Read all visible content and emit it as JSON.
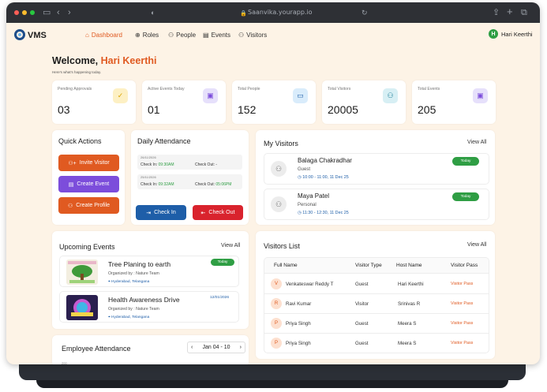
{
  "browser": {
    "url": "Saanvika.yourapp.io"
  },
  "app": {
    "brand": "VMS"
  },
  "nav": {
    "items": [
      {
        "label": "Dashboard",
        "icon": "home-icon"
      },
      {
        "label": "Roles",
        "icon": "roles-icon"
      },
      {
        "label": "People",
        "icon": "people-icon"
      },
      {
        "label": "Events",
        "icon": "calendar-icon"
      },
      {
        "label": "Visitors",
        "icon": "visitors-icon"
      }
    ],
    "user": {
      "initial": "H",
      "name": "Hari Keerthi"
    }
  },
  "welcome": {
    "greeting": "Welcome,",
    "name": "Hari Keerthi",
    "subtitle": "Here's what's happening today."
  },
  "stats": [
    {
      "label": "Pending Approvals",
      "value": "03",
      "color": "#fdf0c4",
      "icon": "check-icon"
    },
    {
      "label": "Active Events Today",
      "value": "01",
      "color": "#e6e0fb",
      "icon": "ticket-icon"
    },
    {
      "label": "Total People",
      "value": "152",
      "color": "#d9ecfb",
      "icon": "briefcase-icon"
    },
    {
      "label": "Total Visitors",
      "value": "20005",
      "color": "#d7eff4",
      "icon": "people-icon"
    },
    {
      "label": "Total Events",
      "value": "205",
      "color": "#e6e0fb",
      "icon": "ticket-icon"
    }
  ],
  "quick_actions": {
    "title": "Quick Actions",
    "buttons": [
      {
        "label": "Invite Visitor",
        "color": "#e05a21"
      },
      {
        "label": "Create Event",
        "color": "#7c4ddb"
      },
      {
        "label": "Create Profile",
        "color": "#e05a21"
      }
    ]
  },
  "attendance": {
    "title": "Daily Attendance",
    "rows": [
      {
        "date": "26/11/2026",
        "check_in_label": "Check In:",
        "check_in": "09:30AM",
        "check_out_label": "Check Out:",
        "check_out": "-"
      },
      {
        "date": "25/11/2026",
        "check_in_label": "Check In:",
        "check_in": "09:32AM",
        "check_out_label": "Check Out:",
        "check_out": "05:06PM"
      }
    ],
    "check_in_button": "Check In",
    "check_out_button": "Check Out"
  },
  "my_visitors": {
    "title": "My Visitors",
    "view_all": "View All",
    "items": [
      {
        "name": "Balaga Chakradhar",
        "type": "Guest",
        "time": "10:00 - 11:00, 11 Dec 25",
        "badge": "Today"
      },
      {
        "name": "Maya Patel",
        "type": "Personal",
        "time": "11:30 - 12:30, 11 Dec 25",
        "badge": "Today"
      }
    ]
  },
  "upcoming_events": {
    "title": "Upcoming Events",
    "view_all": "View All",
    "items": [
      {
        "name": "Tree Planing to earth",
        "organizer": "Organized by : Nature Team",
        "location": "Hyderabad, Telangana",
        "badge": "Today"
      },
      {
        "name": "Health Awareness Drive",
        "organizer": "Organized by : Nature Team",
        "location": "Hyderabad, Telangana",
        "badge": "12/01/2026"
      }
    ]
  },
  "visitors_list": {
    "title": "Visitors List",
    "view_all": "View All",
    "columns": [
      "Full Name",
      "Visitor Type",
      "Host Name",
      "Visitor Pass"
    ],
    "rows": [
      {
        "initial": "V",
        "name": "Venkateswar Reddy T",
        "type": "Guest",
        "host": "Hari Keerthi",
        "pass": "Visitor Pass"
      },
      {
        "initial": "R",
        "name": "Ravi Kumar",
        "type": "Visitor",
        "host": "Srinivas R",
        "pass": "Visitor Pass"
      },
      {
        "initial": "P",
        "name": "Priya Singh",
        "type": "Guest",
        "host": "Meera S",
        "pass": "Visitor Pass"
      },
      {
        "initial": "P",
        "name": "Priya Singh",
        "type": "Guest",
        "host": "Meera S",
        "pass": "Visitor Pass"
      }
    ]
  },
  "employee_attendance": {
    "title": "Employee Attendance",
    "week": "Jan 04 - 10",
    "axis_tick": "200"
  }
}
